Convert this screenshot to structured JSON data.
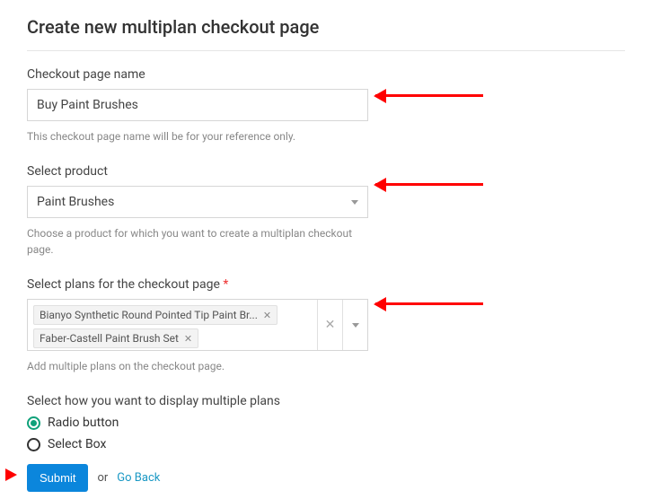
{
  "title": "Create new multiplan checkout page",
  "checkoutName": {
    "label": "Checkout page name",
    "value": "Buy Paint Brushes",
    "help": "This checkout page name will be for your reference only."
  },
  "product": {
    "label": "Select product",
    "value": "Paint Brushes",
    "help": "Choose a product for which you want to create a multiplan checkout page."
  },
  "plans": {
    "label": "Select plans for the checkout page",
    "required": "*",
    "chips": [
      "Bianyo Synthetic Round Pointed Tip Paint Br...",
      "Faber-Castell Paint Brush Set"
    ],
    "help": "Add multiple plans on the checkout page."
  },
  "display": {
    "label": "Select how you want to display multiple plans",
    "options": [
      "Radio button",
      "Select Box"
    ],
    "selected": "Radio button"
  },
  "actions": {
    "submit": "Submit",
    "or": "or",
    "goBack": "Go Back"
  }
}
